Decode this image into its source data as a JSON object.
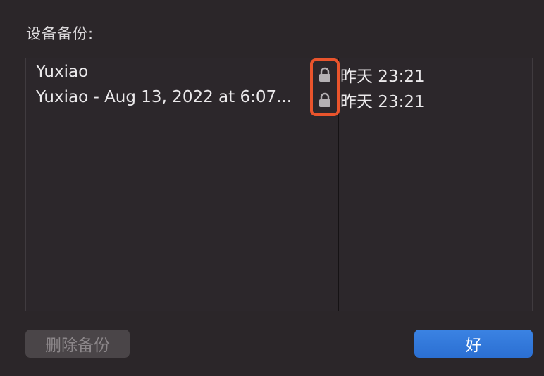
{
  "dialog": {
    "title": "设备备份:"
  },
  "backups": [
    {
      "name": "Yuxiao",
      "date": "昨天 23:21",
      "icon": "lock-icon"
    },
    {
      "name": "Yuxiao - Aug 13, 2022 at 6:07...",
      "date": "昨天 23:21",
      "icon": "lock-icon"
    }
  ],
  "buttons": {
    "delete_label": "删除备份",
    "ok_label": "好"
  },
  "colors": {
    "background": "#2b2629",
    "highlight": "#e9542c",
    "primary_button": "#2f74dc",
    "disabled_button": "#4a4548"
  }
}
